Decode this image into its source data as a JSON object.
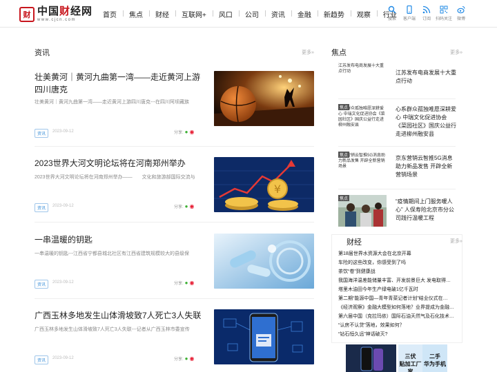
{
  "header": {
    "logo_mark": "财",
    "logo_title_a": "中国",
    "logo_title_b": "财",
    "logo_title_c": "经网",
    "logo_url": "www.cjcn.com",
    "nav": [
      "首页",
      "焦点",
      "财经",
      "互联网+",
      "风口",
      "公司",
      "资讯",
      "金融",
      "新趋势",
      "观察",
      "行业"
    ],
    "tools": [
      {
        "icon": "search-icon",
        "label": "搜索"
      },
      {
        "icon": "phone-icon",
        "label": "客户端"
      },
      {
        "icon": "rss-icon",
        "label": "订阅"
      },
      {
        "icon": "qrcode-icon",
        "label": "扫码关注"
      },
      {
        "icon": "weibo-icon",
        "label": "微博"
      }
    ]
  },
  "news": {
    "title": "资讯",
    "more": "更多»",
    "share_label": "分享:",
    "articles": [
      {
        "title": "壮美黄河｜黄河九曲第一湾——走近黄河上游四川唐克",
        "summary": "壮美黄河｜黄河九曲第一湾——走近黄河上游四川唐克---在四川阿坝藏族",
        "tag": "资讯",
        "date": "2023-09-12"
      },
      {
        "title": "2023世界大河文明论坛将在河南郑州举办",
        "summary": "2023世界大河文明论坛将在河南郑州举办——　　文化和旅游部国际交流与",
        "tag": "资讯",
        "date": "2023-09-12"
      },
      {
        "title": "一串温暖的钥匙",
        "summary": "一串温暖的钥匙---江西省宁都县城北社区有江西省建筑规模较大的县级保",
        "tag": "资讯",
        "date": "2023-09-12"
      },
      {
        "title": "广西玉林多地发生山体滑坡致7人死亡3人失联",
        "summary": "广西玉林多地发生山体滑坡致7人死亡3人失联---记者从广西玉林市委宣传",
        "tag": "资讯",
        "date": "2023-09-12"
      }
    ]
  },
  "hot": {
    "title": "焦点",
    "more": "更多»",
    "items": [
      {
        "thumb_tag": "",
        "thumb_text": "江苏发布电商发展十大重点行动",
        "title": "江苏发布电商发展十大重点行动"
      },
      {
        "thumb_tag": "焦点",
        "thumb_text": "心系群众孤独唯愿深耕爱心 中瑞文化促进协会《菜园社区》国庆公益行走进柳州融安县",
        "title": "心系群众孤独唯愿深耕爱心 中瑞文化促进协会《菜园社区》国庆公益行走进柳州融安县"
      },
      {
        "thumb_tag": "焦点",
        "thumb_text": "京东营销云智推5G消息助力新品发售 开辟全新营销场景",
        "title": "京东营销云智推5G消息助力新品发售 开辟全新营销场景"
      },
      {
        "thumb_tag": "焦点",
        "thumb_text": "",
        "title": "“疫情期间上门服务暖人心” 人保寿险北京市分公司践行温暖工程"
      }
    ]
  },
  "finance": {
    "title": "财经",
    "more": "更多»",
    "items": [
      "第18届世界水资源大会在北京开幕",
      "车险的这些改变，你感受到了吗",
      "茶饮“卷”到健康战",
      "我国海洋温差能储量丰富、开发前景巨大 发电取得…",
      "塔里木油田今年生产绿电破1亿千瓦时",
      "第二期“能源中国—青年青菜记者计划”结业仪式在…",
      "《经济观察》金融大模型如何落地？业界提成为金融…",
      "第六届中国（克拉玛依）国际石油天然气及石化技术…",
      "“认房不认贷”落地，效果如何？",
      "“钻石恒久远”神话破灭?"
    ]
  },
  "ads": [
    {
      "text": ""
    },
    {
      "text": "三伏\n贴加工厂家"
    },
    {
      "text": "二手\n华为手机"
    }
  ],
  "colors": {
    "brand": "#c8161d",
    "accent": "#1e88e5"
  }
}
